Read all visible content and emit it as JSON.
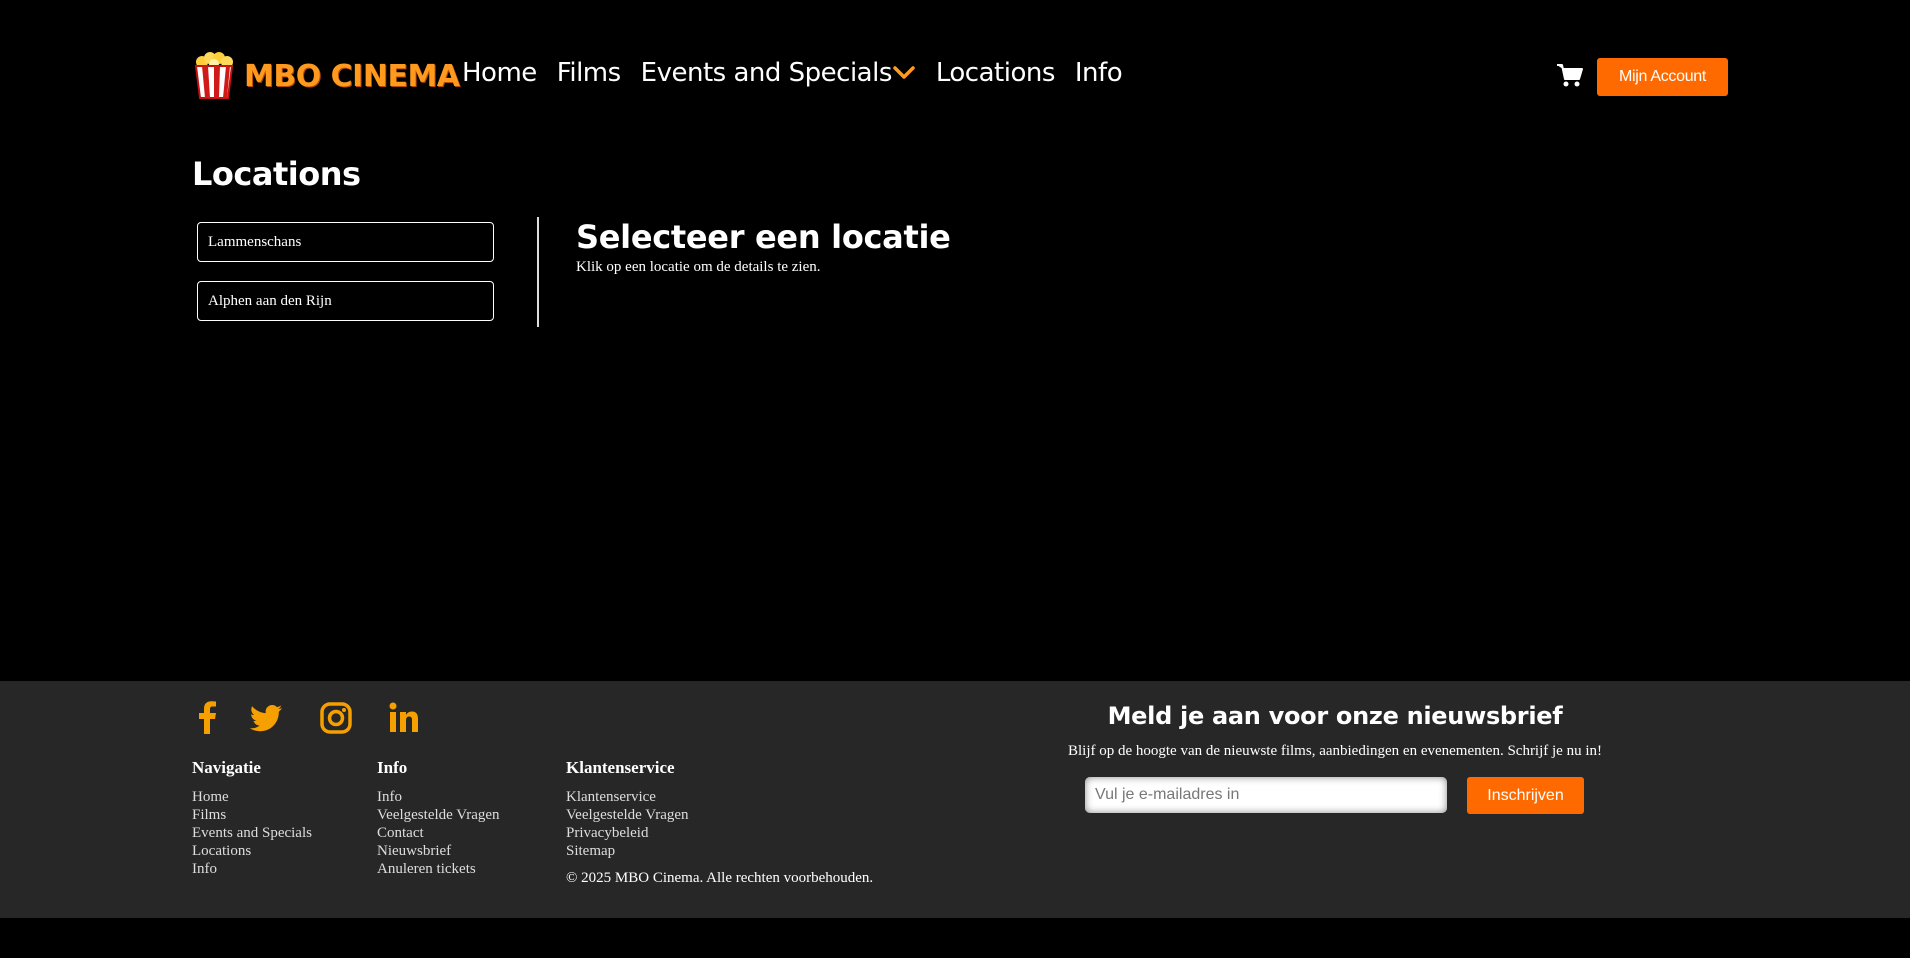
{
  "colors": {
    "background": "#000000",
    "accent": "#ff6a00",
    "logo": "#ff9a1f",
    "footer_bg": "#272727",
    "social_icons": "#f5a000"
  },
  "header": {
    "logo_text": "MBO CINEMA",
    "logo_icon": "popcorn-icon",
    "nav": [
      "Home",
      "Films",
      "Events and Specials",
      "Locations",
      "Info"
    ],
    "dropdown_icon": "chevron-down-icon",
    "cart_icon": "cart-icon",
    "account_label": "Mijn Account"
  },
  "main": {
    "title": "Locations",
    "locations": [
      "Lammenschans",
      "Alphen aan den Rijn"
    ],
    "detail_title": "Selecteer een locatie",
    "detail_sub": "Klik op een locatie om de details te zien."
  },
  "footer": {
    "socials": [
      "facebook-icon",
      "twitter-icon",
      "instagram-icon",
      "linkedin-icon"
    ],
    "columns": [
      {
        "title": "Navigatie",
        "links": [
          "Home",
          "Films",
          "Events and Specials",
          "Locations",
          "Info"
        ]
      },
      {
        "title": "Info",
        "links": [
          "Info",
          "Veelgestelde Vragen",
          "Contact",
          "Nieuwsbrief",
          "Anuleren tickets"
        ]
      },
      {
        "title": "Klantenservice",
        "links": [
          "Klantenservice",
          "Veelgestelde Vragen",
          "Privacybeleid",
          "Sitemap"
        ]
      }
    ],
    "copyright": "© 2025 MBO Cinema. Alle rechten voorbehouden.",
    "newsletter": {
      "title": "Meld je aan voor onze nieuwsbrief",
      "subtitle": "Blijf op de hoogte van de nieuwste films, aanbiedingen en evenementen. Schrijf je nu in!",
      "placeholder": "Vul je e-mailadres in",
      "button": "Inschrijven"
    }
  }
}
